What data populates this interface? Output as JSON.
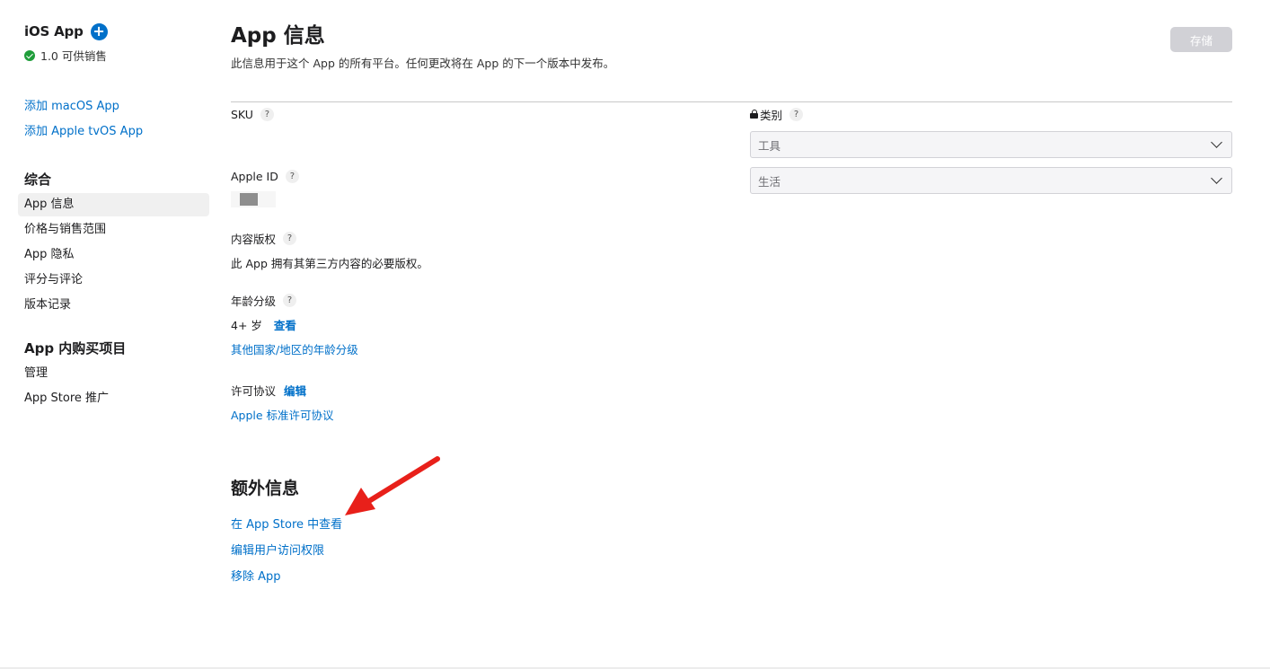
{
  "sidebar": {
    "platform_title": "iOS App",
    "version_status": "1.0 可供销售",
    "add_links": [
      "添加 macOS App",
      "添加 Apple tvOS App"
    ],
    "general_title": "综合",
    "general_items": [
      "App 信息",
      "价格与销售范围",
      "App 隐私",
      "评分与评论",
      "版本记录"
    ],
    "iap_title": "App 内购买项目",
    "iap_items": [
      "管理",
      "App Store 推广"
    ]
  },
  "header": {
    "title": "App 信息",
    "subtitle": "此信息用于这个 App 的所有平台。任何更改将在 App 的下一个版本中发布。",
    "save_label": "存储"
  },
  "fields": {
    "sku_label": "SKU",
    "apple_id_label": "Apple ID",
    "copyright_label": "内容版权",
    "copyright_value": "此 App 拥有其第三方内容的必要版权。",
    "age_label": "年龄分级",
    "age_value": "4+ 岁",
    "age_view_link": "查看",
    "age_other_link": "其他国家/地区的年龄分级",
    "license_label": "许可协议",
    "license_edit_link": "编辑",
    "license_value_link": "Apple 标准许可协议",
    "help_glyph": "?"
  },
  "category": {
    "label": "类别",
    "primary": "工具",
    "secondary": "生活"
  },
  "extra": {
    "title": "额外信息",
    "links": [
      "在 App Store 中查看",
      "编辑用户访问权限",
      "移除 App"
    ]
  },
  "colors": {
    "link": "#0070c9",
    "save_disabled": "#d1d1d6",
    "status_ok": "#1f9d3a",
    "arrow": "#e8201a"
  }
}
